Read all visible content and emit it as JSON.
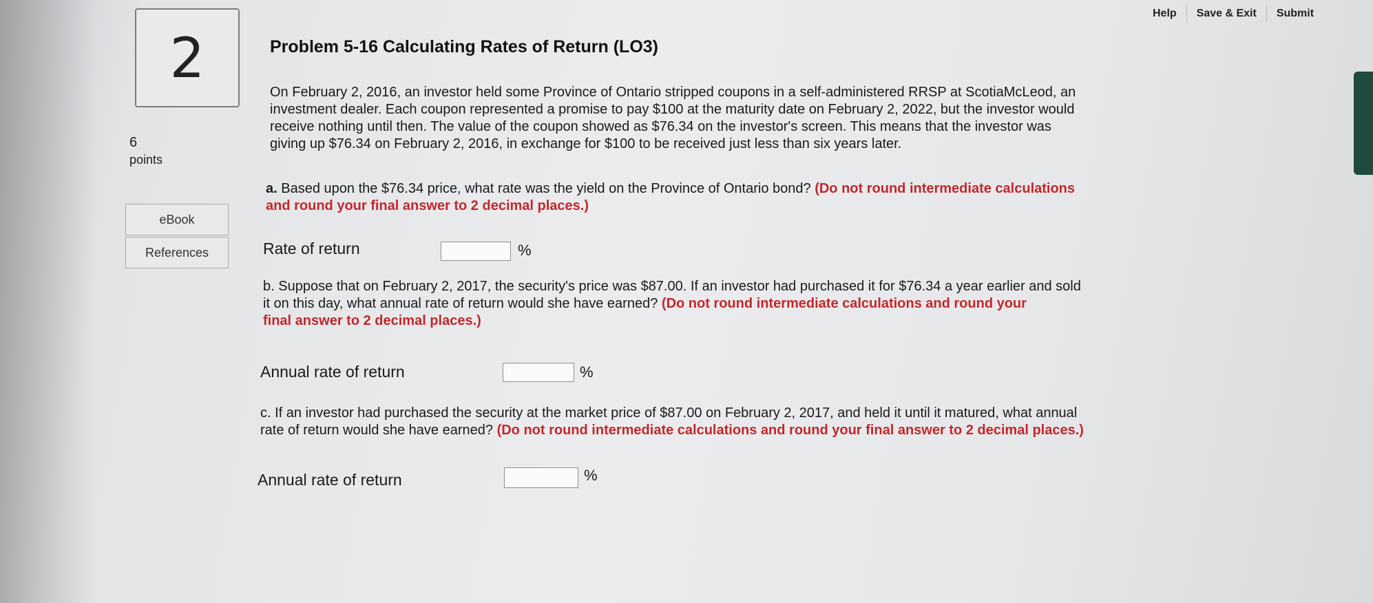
{
  "topnav": {
    "help": "Help",
    "save_exit": "Save & Exit",
    "submit": "Submit"
  },
  "question": {
    "number": "2",
    "points_value": "6",
    "points_label": "points"
  },
  "side": {
    "ebook": "eBook",
    "references": "References"
  },
  "problem": {
    "title": "Problem 5-16 Calculating Rates of Return (LO3)",
    "intro_lines": [
      "On February 2, 2016, an investor held some Province of Ontario stripped coupons in a self-administered RRSP at ScotiaMcLeod, an",
      "investment dealer. Each coupon represented a promise to pay $100 at the maturity date on February 2, 2022, but the investor would",
      "receive nothing until then. The value of the coupon showed as $76.34 on the investor's screen. This means that the investor was",
      "giving up $76.34 on February 2, 2016, in exchange for $100 to be received just less than six years later."
    ],
    "part_a": {
      "letter": "a.",
      "line1_text": "Based upon the $76.34 price, what rate was the yield on the Province of Ontario bond?",
      "line1_red": "(Do not round intermediate calculations",
      "line2_red": "and round your final answer to 2 decimal places.)",
      "answer_label": "Rate of return",
      "answer_value": "",
      "unit": "%"
    },
    "part_b": {
      "line1": "b. Suppose that on February 2, 2017, the security's price was $87.00. If an investor had purchased it for $76.34 a year earlier and sold",
      "line2_text": "it on this day, what annual rate of return would she have earned?",
      "line2_red": "(Do not round intermediate calculations and round your",
      "line3_red": "final answer to 2 decimal places.)",
      "answer_label": "Annual rate of return",
      "answer_value": "",
      "unit": "%"
    },
    "part_c": {
      "line1": "c. If an investor had purchased the security at the market price of $87.00 on February 2, 2017, and held it until it matured, what annual",
      "line2_text": "rate of return would she have earned?",
      "line2_red": "(Do not round intermediate calculations and round your final answer to 2 decimal places.)",
      "answer_label": "Annual rate of return",
      "answer_value": "",
      "unit": "%"
    }
  }
}
